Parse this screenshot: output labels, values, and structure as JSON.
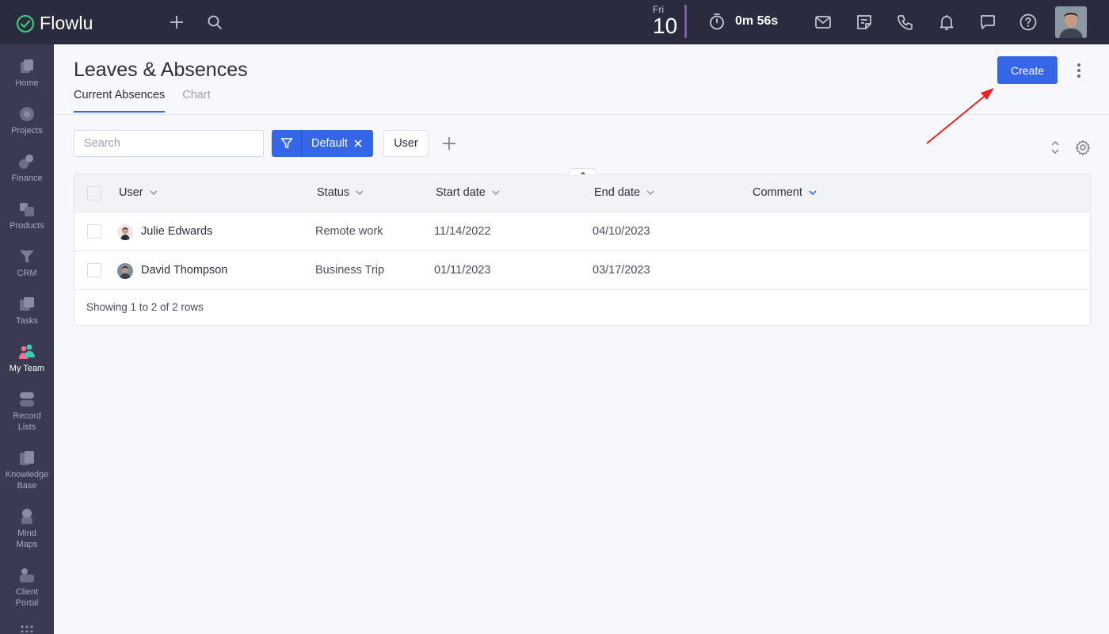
{
  "app": {
    "name": "Flowlu"
  },
  "topbar": {
    "date_dow": "Fri",
    "date_day": "10",
    "timer": "0m 56s"
  },
  "sidebar": {
    "items": [
      {
        "label": "Home",
        "icon": "home-icon"
      },
      {
        "label": "Projects",
        "icon": "projects-icon"
      },
      {
        "label": "Finance",
        "icon": "finance-icon"
      },
      {
        "label": "Products",
        "icon": "products-icon"
      },
      {
        "label": "CRM",
        "icon": "crm-icon"
      },
      {
        "label": "Tasks",
        "icon": "tasks-icon"
      },
      {
        "label": "My Team",
        "icon": "my-team-icon",
        "active": true
      },
      {
        "label": "Record Lists",
        "icon": "record-lists-icon"
      },
      {
        "label": "Knowledge Base",
        "icon": "knowledge-base-icon"
      },
      {
        "label": "Mind Maps",
        "icon": "mind-maps-icon"
      },
      {
        "label": "Client Portal",
        "icon": "client-portal-icon"
      }
    ]
  },
  "page": {
    "title": "Leaves & Absences",
    "tabs": [
      {
        "label": "Current Absences",
        "active": true
      },
      {
        "label": "Chart",
        "active": false
      }
    ],
    "create_label": "Create"
  },
  "filters": {
    "search_placeholder": "Search",
    "active_filter": "Default",
    "user_chip": "User"
  },
  "table": {
    "columns": [
      "User",
      "Status",
      "Start date",
      "End date",
      "Comment"
    ],
    "rows": [
      {
        "user": "Julie Edwards",
        "status": "Remote work",
        "start": "11/14/2022",
        "end": "04/10/2023",
        "comment": ""
      },
      {
        "user": "David Thompson",
        "status": "Business Trip",
        "start": "01/11/2023",
        "end": "03/17/2023",
        "comment": ""
      }
    ],
    "footer": "Showing 1 to 2 of 2 rows"
  },
  "colors": {
    "accent": "#3566e8",
    "topbar_bg": "#2a2b3f",
    "sidebar_bg": "#3a3b52",
    "annotation_arrow": "#e8231f"
  }
}
